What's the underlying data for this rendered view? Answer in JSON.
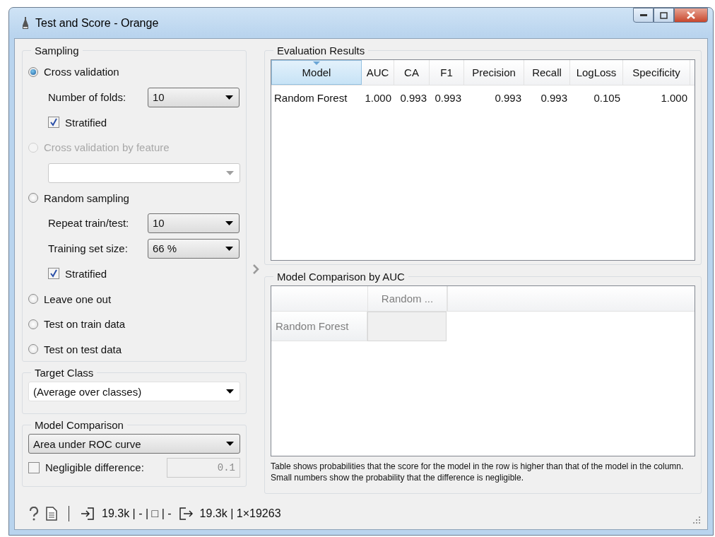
{
  "window": {
    "title": "Test and Score - Orange"
  },
  "sampling": {
    "title": "Sampling",
    "items": [
      {
        "kind": "radio",
        "label": "Cross validation",
        "selected": true,
        "disabled": false
      },
      {
        "kind": "combo",
        "label": "Number of folds:",
        "value": "10",
        "disabled": false
      },
      {
        "kind": "check",
        "label": "Stratified",
        "checked": true
      },
      {
        "kind": "radio",
        "label": "Cross validation by feature",
        "selected": false,
        "disabled": true
      },
      {
        "kind": "combo",
        "disabled": true
      },
      {
        "kind": "radio",
        "label": "Random sampling",
        "selected": false,
        "disabled": false
      },
      {
        "kind": "combo",
        "label": "Repeat train/test:",
        "value": "10",
        "disabled": false
      },
      {
        "kind": "combo",
        "label": "Training set size:",
        "value": "66 %",
        "disabled": false
      },
      {
        "kind": "check",
        "label": "Stratified",
        "checked": true
      },
      {
        "kind": "radio",
        "label": "Leave one out",
        "selected": false,
        "disabled": false
      },
      {
        "kind": "radio",
        "label": "Test on train data",
        "selected": false,
        "disabled": false
      },
      {
        "kind": "radio",
        "label": "Test on test data",
        "selected": false,
        "disabled": false
      }
    ]
  },
  "target_class": {
    "title": "Target Class",
    "value": "(Average over classes)"
  },
  "model_comparison": {
    "title": "Model Comparison",
    "value": "Area under ROC curve",
    "negligible": {
      "label": "Negligible difference:",
      "checked": false,
      "value": "0.1"
    }
  },
  "evaluation_results": {
    "title": "Evaluation Results",
    "columns": [
      {
        "label": "Model",
        "sorted": true
      },
      {
        "label": "AUC",
        "sorted": false
      },
      {
        "label": "CA",
        "sorted": false
      },
      {
        "label": "F1",
        "sorted": false
      },
      {
        "label": "Precision",
        "sorted": false
      },
      {
        "label": "Recall",
        "sorted": false
      },
      {
        "label": "LogLoss",
        "sorted": false
      },
      {
        "label": "Specificity",
        "sorted": false
      }
    ],
    "rows": [
      [
        "Random Forest",
        "1.000",
        "0.993",
        "0.993",
        "0.993",
        "0.993",
        "0.105",
        "1.000"
      ]
    ]
  },
  "comparison": {
    "title": "Model Comparison by AUC",
    "column_headers": [
      "Random ..."
    ],
    "row_headers": [
      "Random Forest"
    ],
    "note": "Table shows probabilities that the score for the model in the row is higher than that of the model in the column. Small numbers show the probability that the difference is negligible."
  },
  "status_bar": {
    "input": "19.3k | - | □ | -",
    "output": "19.3k | 1×19263"
  }
}
